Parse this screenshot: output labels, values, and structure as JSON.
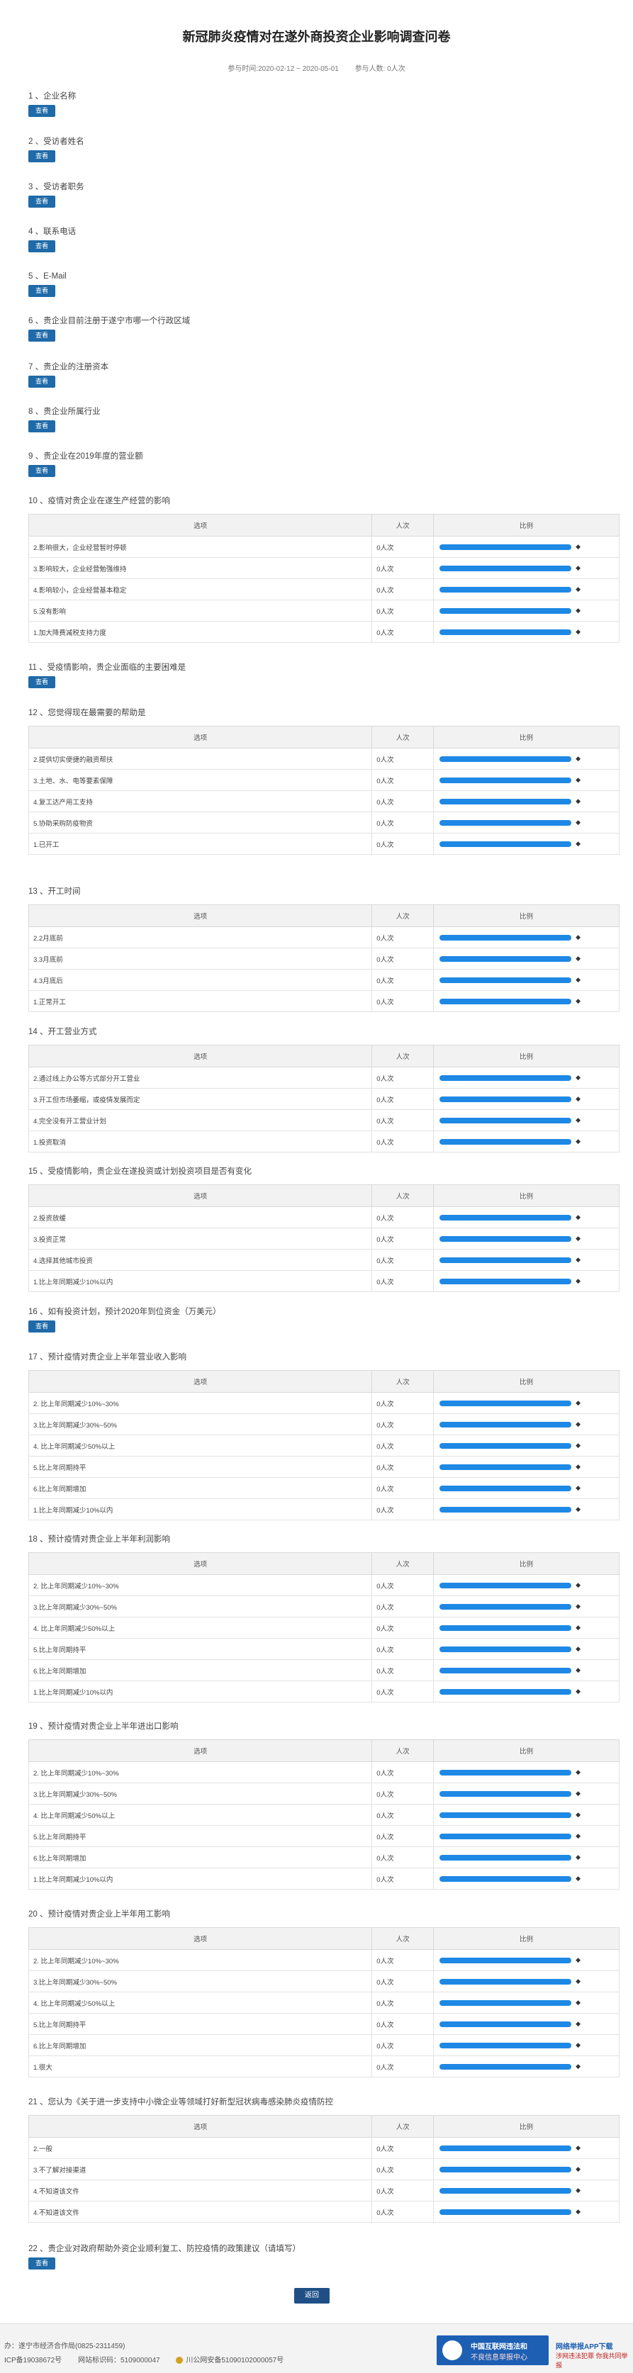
{
  "header": {
    "title": "新冠肺炎疫情对在遂外商投资企业影响调查问卷",
    "time_label": "参与时间:2020-02-12 ~ 2020-05-01",
    "count_label": "参与人数: 0人次"
  },
  "common": {
    "view_label": "查看",
    "col_option": "选项",
    "col_count": "人次",
    "col_ratio": "比例",
    "count_value": "0人次",
    "ratio_value": 1.0,
    "diamond": "◆",
    "bar_color": "#1e88e5"
  },
  "questions": [
    {
      "title": "1 、企业名称",
      "type": "view"
    },
    {
      "title": "2 、受访者姓名",
      "type": "view"
    },
    {
      "title": "3 、受访者职务",
      "type": "view"
    },
    {
      "title": "4 、联系电话",
      "type": "view"
    },
    {
      "title": "5 、E-Mail",
      "type": "view"
    },
    {
      "title": "6 、贵企业目前注册于遂宁市哪一个行政区域",
      "type": "view"
    },
    {
      "title": "7 、贵企业的注册资本",
      "type": "view"
    },
    {
      "title": "8 、贵企业所属行业",
      "type": "view"
    },
    {
      "title": "9 、贵企业在2019年度的营业额",
      "type": "view"
    },
    {
      "title": "10 、疫情对贵企业在遂生产经营的影响",
      "type": "table",
      "options": [
        "2.影响很大，企业经营暂时停顿",
        "3.影响较大，企业经营勉强维持",
        "4.影响较小，企业经营基本稳定",
        "5.没有影响",
        "1.加大降费减税支持力度"
      ]
    },
    {
      "title": "11 、受疫情影响，贵企业面临的主要困难是",
      "type": "view"
    },
    {
      "title": "12 、您觉得现在最需要的帮助是",
      "type": "table",
      "options": [
        "2.提供切实便捷的融资帮扶",
        "3.土地、水、电等要素保障",
        "4.复工达产用工支持",
        "5.协助采购防疫物资",
        "1.已开工"
      ]
    },
    {
      "title": "13 、开工时间",
      "type": "table",
      "options": [
        "2.2月底前",
        "3.3月底前",
        "4.3月底后",
        "1.正常开工"
      ]
    },
    {
      "title": "14 、开工营业方式",
      "type": "table",
      "options": [
        "2.通过线上办公等方式部分开工营业",
        "3.开工但市场萎缩，或疫情发展而定",
        "4.完全没有开工营业计划",
        "1.投资取消"
      ]
    },
    {
      "title": "15 、受疫情影响，贵企业在遂投资或计划投资项目是否有变化",
      "type": "table",
      "options": [
        "2.投资放缓",
        "3.投资正常",
        "4.选择其他城市投资",
        "1.比上年同期减少10%以内"
      ]
    },
    {
      "title": "16 、如有投资计划，预计2020年到位资金（万美元）",
      "type": "view"
    },
    {
      "title": "17 、预计疫情对贵企业上半年营业收入影响",
      "type": "table",
      "options": [
        "2. 比上年同期减少10%~30%",
        "3.比上年同期减少30%~50%",
        "4. 比上年同期减少50%以上",
        "5.比上年同期持平",
        "6.比上年同期增加",
        "1.比上年同期减少10%以内"
      ]
    },
    {
      "title": "18 、预计疫情对贵企业上半年利润影响",
      "type": "table",
      "options": [
        "2. 比上年同期减少10%~30%",
        "3.比上年同期减少30%~50%",
        "4. 比上年同期减少50%以上",
        "5.比上年同期持平",
        "6.比上年同期增加",
        "1.比上年同期减少10%以内"
      ]
    },
    {
      "title": "19 、预计疫情对贵企业上半年进出口影响",
      "type": "table",
      "options": [
        "2. 比上年同期减少10%~30%",
        "3.比上年同期减少30%~50%",
        "4. 比上年同期减少50%以上",
        "5.比上年同期持平",
        "6.比上年同期增加",
        "1.比上年同期减少10%以内"
      ]
    },
    {
      "title": "20 、预计疫情对贵企业上半年用工影响",
      "type": "table",
      "options": [
        "2. 比上年同期减少10%~30%",
        "3.比上年同期减少30%~50%",
        "4. 比上年同期减少50%以上",
        "5.比上年同期持平",
        "6.比上年同期增加",
        "1.很大"
      ]
    },
    {
      "title": "21 、您认为《关于进一步支持中小微企业等领域打好新型冠状病毒感染肺炎疫情防控",
      "type": "table",
      "options": [
        "2.一般",
        "3.不了解对接渠道",
        "4.不知道该文件",
        "4.不知道该文件"
      ]
    },
    {
      "title": "22 、贵企业对政府帮助外资企业顺利复工、防控疫情的政策建议（请填写）",
      "type": "view"
    }
  ],
  "submit_label": "返回",
  "footer": {
    "line1": "办：遂宁市经济合作局(0825-2311459)",
    "icp": "ICP备19038672号",
    "site_code": "网站标识码：5109000047",
    "police": "川公网安备51090102000057号",
    "badge1_title": "中国互联网违法和",
    "badge1_sub": "不良信息举报中心",
    "badge2_title": "网络举报APP下载",
    "badge2_sub": "涉网违法犯罪 你我共同举报"
  }
}
